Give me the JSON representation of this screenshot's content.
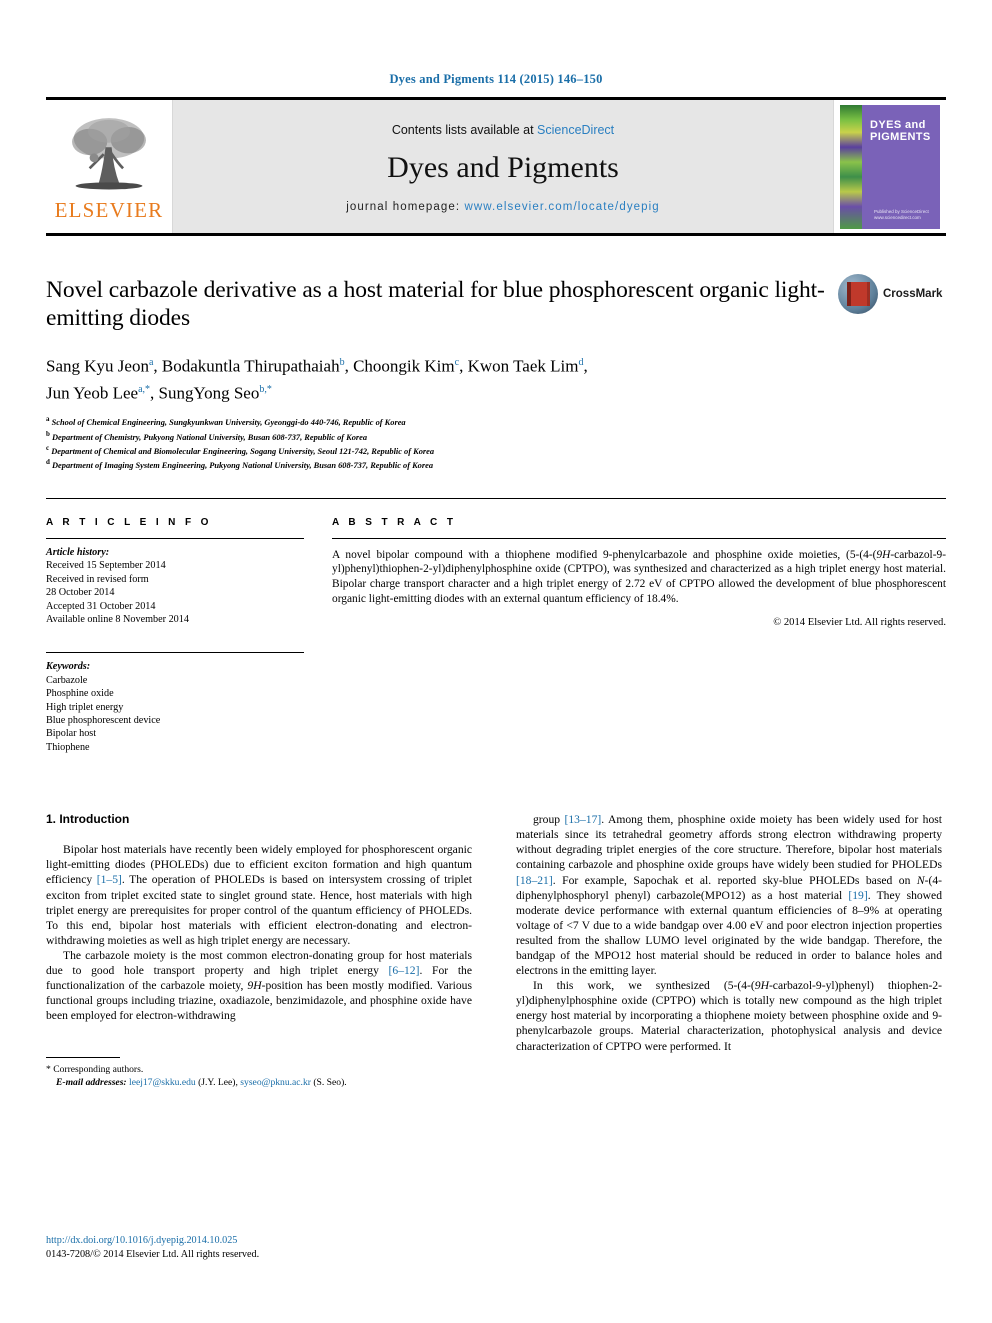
{
  "running_head": "Dyes and Pigments 114 (2015) 146–150",
  "masthead": {
    "publisher_logo_text": "ELSEVIER",
    "contents_prefix": "Contents lists available at ",
    "contents_link": "ScienceDirect",
    "journal_title": "Dyes and Pigments",
    "homepage_label": "journal homepage: ",
    "homepage_url": "www.elsevier.com/locate/dyepig",
    "cover_title": "DYES and PIGMENTS",
    "cover_publisher": "Published by\nScienceDirect\nwww.sciencedirect.com"
  },
  "article": {
    "title": "Novel carbazole derivative as a host material for blue phosphorescent organic light-emitting diodes",
    "crossmark_label": "CrossMark",
    "authors_line1": "Sang Kyu Jeon a, Bodakuntla Thirupathaiah b, Choongik Kim c, Kwon Taek Lim d,",
    "authors_line2": "Jun Yeob Lee a,*, SungYong Seo b,*",
    "affiliations": [
      "a School of Chemical Engineering, Sungkyunkwan University, Gyeonggi-do 440-746, Republic of Korea",
      "b Department of Chemistry, Pukyong National University, Busan 608-737, Republic of Korea",
      "c Department of Chemical and Biomolecular Engineering, Sogang University, Seoul 121-742, Republic of Korea",
      "d Department of Imaging System Engineering, Pukyong National University, Busan 608-737, Republic of Korea"
    ]
  },
  "article_info": {
    "heading": "A R T I C L E   I N F O",
    "history_label": "Article history:",
    "history": [
      "Received 15 September 2014",
      "Received in revised form",
      "28 October 2014",
      "Accepted 31 October 2014",
      "Available online 8 November 2014"
    ],
    "keywords_label": "Keywords:",
    "keywords": [
      "Carbazole",
      "Phosphine oxide",
      "High triplet energy",
      "Blue phosphorescent device",
      "Bipolar host",
      "Thiophene"
    ]
  },
  "abstract": {
    "heading": "A B S T R A C T",
    "text": "A novel bipolar compound with a thiophene modified 9-phenylcarbazole and phosphine oxide moieties, (5-(4-(9H-carbazol-9-yl)phenyl)thiophen-2-yl)diphenylphosphine oxide (CPTPO), was synthesized and characterized as a high triplet energy host material. Bipolar charge transport character and a high triplet energy of 2.72 eV of CPTPO allowed the development of blue phosphorescent organic light-emitting diodes with an external quantum efficiency of 18.4%.",
    "copyright": "© 2014 Elsevier Ltd. All rights reserved."
  },
  "body": {
    "section_heading": "1. Introduction",
    "left_p1": "Bipolar host materials have recently been widely employed for phosphorescent organic light-emitting diodes (PHOLEDs) due to efficient exciton formation and high quantum efficiency [1–5]. The operation of PHOLEDs is based on intersystem crossing of triplet exciton from triplet excited state to singlet ground state. Hence, host materials with high triplet energy are prerequisites for proper control of the quantum efficiency of PHOLEDs. To this end, bipolar host materials with efficient electron-donating and electron-withdrawing moieties as well as high triplet energy are necessary.",
    "left_p2": "The carbazole moiety is the most common electron-donating group for host materials due to good hole transport property and high triplet energy [6–12]. For the functionalization of the carbazole moiety, 9H-position has been mostly modified. Various functional groups including triazine, oxadiazole, benzimidazole, and phosphine oxide have been employed for electron-withdrawing",
    "right_p1": "group [13–17]. Among them, phosphine oxide moiety has been widely used for host materials since its tetrahedral geometry affords strong electron withdrawing property without degrading triplet energies of the core structure. Therefore, bipolar host materials containing carbazole and phosphine oxide groups have widely been studied for PHOLEDs [18–21]. For example, Sapochak et al. reported sky-blue PHOLEDs based on N-(4-diphenylphosphoryl phenyl) carbazole(MPO12) as a host material [19]. They showed moderate device performance with external quantum efficiencies of 8–9% at operating voltage of <7 V due to a wide bandgap over 4.00 eV and poor electron injection properties resulted from the shallow LUMO level originated by the wide bandgap. Therefore, the bandgap of the MPO12 host material should be reduced in order to balance holes and electrons in the emitting layer.",
    "right_p2": "In this work, we synthesized (5-(4-(9H-carbazol-9-yl)phenyl) thiophen-2-yl)diphenylphosphine oxide (CPTPO) which is totally new compound as the high triplet energy host material by incorporating a thiophene moiety between phosphine oxide and 9-phenylcarbazole groups. Material characterization, photophysical analysis and device characterization of CPTPO were performed. It"
  },
  "footnote": {
    "corresponding": "* Corresponding authors.",
    "email_label": "E-mail addresses:",
    "email1": "leej17@skku.edu",
    "email1_who": "(J.Y. Lee),",
    "email2": "syseo@pknu.ac.kr",
    "email2_who": "(S. Seo)."
  },
  "page_footer": {
    "doi": "http://dx.doi.org/10.1016/j.dyepig.2014.10.025",
    "issn_line": "0143-7208/© 2014 Elsevier Ltd. All rights reserved."
  },
  "colors": {
    "link": "#1a6ea8",
    "elsevier_orange": "#E87B1E",
    "masthead_grey": "#e6e6e6",
    "cover_purple": "#7a62b8"
  }
}
